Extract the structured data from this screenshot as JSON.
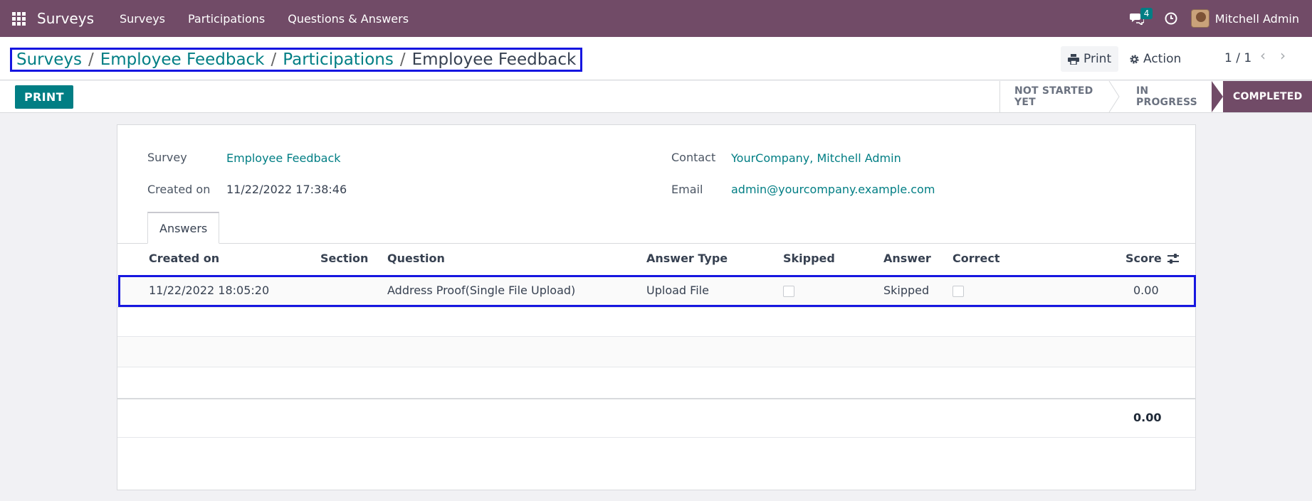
{
  "navbar": {
    "app_title": "Surveys",
    "menu": [
      "Surveys",
      "Participations",
      "Questions & Answers"
    ],
    "messages_badge": "4",
    "user_name": "Mitchell Admin"
  },
  "breadcrumb": {
    "items": [
      "Surveys",
      "Employee Feedback",
      "Participations"
    ],
    "current": "Employee Feedback"
  },
  "control": {
    "print_label": "Print",
    "action_label": "Action",
    "pager": "1 / 1"
  },
  "statusbar": {
    "print_button": "PRINT",
    "stages": [
      "NOT STARTED YET",
      "IN PROGRESS",
      "COMPLETED"
    ],
    "active_stage": "COMPLETED"
  },
  "form": {
    "survey_label": "Survey",
    "survey_value": "Employee Feedback",
    "created_label": "Created on",
    "created_value": "11/22/2022 17:38:46",
    "contact_label": "Contact",
    "contact_value": "YourCompany, Mitchell Admin",
    "email_label": "Email",
    "email_value": "admin@yourcompany.example.com"
  },
  "tabs": {
    "answers": "Answers"
  },
  "table": {
    "headers": [
      "Created on",
      "Section",
      "Question",
      "Answer Type",
      "Skipped",
      "Answer",
      "Correct",
      "Score"
    ],
    "rows": [
      {
        "created_on": "11/22/2022 18:05:20",
        "section": "",
        "question": "Address Proof(Single File Upload)",
        "answer_type": "Upload File",
        "skipped": false,
        "answer": "Skipped",
        "correct": false,
        "score": "0.00"
      }
    ],
    "total_score": "0.00"
  },
  "colors": {
    "brand": "#714b67",
    "accent": "#017e84",
    "highlight_border": "#1616e0"
  }
}
